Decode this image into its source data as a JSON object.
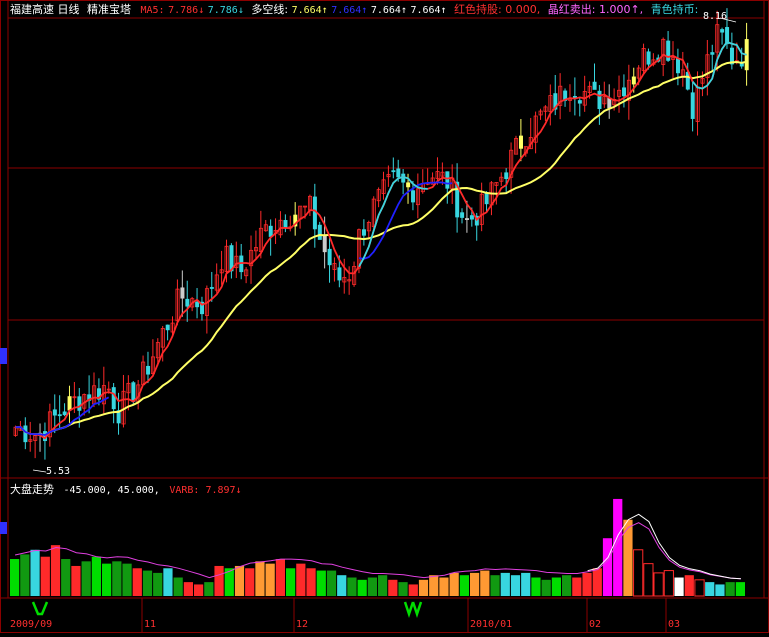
{
  "header": {
    "stock_name": "福建高速",
    "period": "日线",
    "indicator_name": "精准宝塔",
    "ma_label": "MA5:",
    "ma_value1": "7.786↓",
    "ma_value2": "7.786↓",
    "duokong_label": "多空线:",
    "duokong_value1": "7.664↑",
    "duokong_value2": "7.664↑",
    "duokong_value3": "7.664↑",
    "duokong_value4": "7.664↑",
    "red_hold": "红色持股: 0.000,",
    "crystal_sell": "晶红卖出: 1.000↑,",
    "cyan_hold": "青色持币:"
  },
  "sub_header": {
    "name": "大盘走势",
    "range": "-45.000, 45.000,",
    "varb": "VARB: 7.897↓"
  },
  "price_labels": {
    "high": "8.16",
    "low": "5.53"
  },
  "date_labels": [
    "2009/09",
    "11",
    "12",
    "2010/01",
    "02",
    "03"
  ],
  "colors": {
    "background": "#000000",
    "frame": "#8b0000",
    "up": "#ff2a2a",
    "down": "#38d6e0",
    "magenta": "#ff00ff",
    "yellow_line": "#ffff66",
    "blue_line": "#2020ff",
    "green_bar": "#00dd00",
    "dark_green_bar": "#119911",
    "orange_bar": "#ff9933",
    "white_bar": "#ffffff",
    "purple_line": "#e040e0"
  },
  "chart_data": {
    "type": "candlestick",
    "price_range": [
      5.45,
      8.25
    ],
    "sub_range": [
      -45,
      45
    ],
    "price_path": [
      [
        0,
        5.75
      ],
      [
        10,
        5.7
      ],
      [
        20,
        5.85
      ],
      [
        30,
        5.95
      ],
      [
        40,
        6.0
      ],
      [
        45,
        5.85
      ],
      [
        55,
        6.05
      ],
      [
        65,
        6.35
      ],
      [
        72,
        6.55
      ],
      [
        82,
        6.5
      ],
      [
        90,
        6.8
      ],
      [
        98,
        6.7
      ],
      [
        108,
        6.95
      ],
      [
        118,
        7.05
      ],
      [
        128,
        7.08
      ],
      [
        135,
        6.8
      ],
      [
        140,
        6.65
      ],
      [
        146,
        6.7
      ],
      [
        150,
        6.95
      ],
      [
        156,
        7.1
      ],
      [
        164,
        7.25
      ],
      [
        172,
        7.2
      ],
      [
        180,
        7.3
      ],
      [
        188,
        7.25
      ],
      [
        196,
        7.0
      ],
      [
        204,
        7.1
      ],
      [
        212,
        7.3
      ],
      [
        222,
        7.55
      ],
      [
        232,
        7.7
      ],
      [
        242,
        7.85
      ],
      [
        252,
        7.75
      ],
      [
        262,
        7.8
      ],
      [
        272,
        8.0
      ],
      [
        282,
        8.1
      ],
      [
        290,
        7.95
      ],
      [
        295,
        7.7
      ],
      [
        300,
        7.95
      ],
      [
        306,
        8.16
      ],
      [
        312,
        8.0
      ],
      [
        318,
        8.05
      ]
    ],
    "candle_colors": [
      "up",
      "down",
      "up",
      "up",
      "up",
      "down",
      "up",
      "up",
      "magenta",
      "down",
      "up",
      "down",
      "up",
      "up",
      "up",
      "down",
      "down",
      "up",
      "up",
      "up",
      "up",
      "down",
      "up",
      "up",
      "down",
      "up",
      "up",
      "up",
      "up",
      "up",
      "down",
      "up",
      "up",
      "magenta",
      "down",
      "down",
      "up",
      "up",
      "magenta",
      "down"
    ],
    "sub_bars": [
      {
        "v": 16,
        "c": "green_bar"
      },
      {
        "v": 18,
        "c": "dark_green_bar"
      },
      {
        "v": 20,
        "c": "down"
      },
      {
        "v": 17,
        "c": "up"
      },
      {
        "v": 22,
        "c": "up"
      },
      {
        "v": 16,
        "c": "dark_green_bar"
      },
      {
        "v": 13,
        "c": "up"
      },
      {
        "v": 15,
        "c": "dark_green_bar"
      },
      {
        "v": 17,
        "c": "green_bar"
      },
      {
        "v": 14,
        "c": "green_bar"
      },
      {
        "v": 15,
        "c": "dark_green_bar"
      },
      {
        "v": 14,
        "c": "dark_green_bar"
      },
      {
        "v": 12,
        "c": "up"
      },
      {
        "v": 11,
        "c": "dark_green_bar"
      },
      {
        "v": 10,
        "c": "dark_green_bar"
      },
      {
        "v": 12,
        "c": "down"
      },
      {
        "v": 8,
        "c": "dark_green_bar"
      },
      {
        "v": 6,
        "c": "up"
      },
      {
        "v": 5,
        "c": "up"
      },
      {
        "v": 6,
        "c": "dark_green_bar"
      },
      {
        "v": 13,
        "c": "up"
      },
      {
        "v": 12,
        "c": "green_bar"
      },
      {
        "v": 13,
        "c": "orange_bar"
      },
      {
        "v": 12,
        "c": "up"
      },
      {
        "v": 15,
        "c": "orange_bar"
      },
      {
        "v": 14,
        "c": "orange_bar"
      },
      {
        "v": 16,
        "c": "up"
      },
      {
        "v": 12,
        "c": "green_bar"
      },
      {
        "v": 14,
        "c": "up"
      },
      {
        "v": 12,
        "c": "up"
      },
      {
        "v": 11,
        "c": "green_bar"
      },
      {
        "v": 11,
        "c": "dark_green_bar"
      },
      {
        "v": 9,
        "c": "down"
      },
      {
        "v": 8,
        "c": "dark_green_bar"
      },
      {
        "v": 7,
        "c": "green_bar"
      },
      {
        "v": 8,
        "c": "dark_green_bar"
      },
      {
        "v": 9,
        "c": "dark_green_bar"
      },
      {
        "v": 7,
        "c": "up"
      },
      {
        "v": 6,
        "c": "dark_green_bar"
      },
      {
        "v": 5,
        "c": "up"
      },
      {
        "v": 7,
        "c": "orange_bar"
      },
      {
        "v": 9,
        "c": "orange_bar"
      },
      {
        "v": 8,
        "c": "orange_bar"
      },
      {
        "v": 10,
        "c": "orange_bar"
      },
      {
        "v": 9,
        "c": "green_bar"
      },
      {
        "v": 10,
        "c": "orange_bar"
      },
      {
        "v": 11,
        "c": "orange_bar"
      },
      {
        "v": 9,
        "c": "dark_green_bar"
      },
      {
        "v": 10,
        "c": "down"
      },
      {
        "v": 9,
        "c": "down"
      },
      {
        "v": 10,
        "c": "down"
      },
      {
        "v": 8,
        "c": "green_bar"
      },
      {
        "v": 7,
        "c": "dark_green_bar"
      },
      {
        "v": 8,
        "c": "green_bar"
      },
      {
        "v": 9,
        "c": "dark_green_bar"
      },
      {
        "v": 8,
        "c": "up"
      },
      {
        "v": 10,
        "c": "up"
      },
      {
        "v": 12,
        "c": "up"
      },
      {
        "v": 25,
        "c": "magenta"
      },
      {
        "v": 42,
        "c": "magenta"
      },
      {
        "v": 33,
        "c": "orange_bar"
      },
      {
        "v": 20,
        "c": "outline"
      },
      {
        "v": 14,
        "c": "outline"
      },
      {
        "v": 10,
        "c": "outline"
      },
      {
        "v": 11,
        "c": "outline"
      },
      {
        "v": 8,
        "c": "white_bar"
      },
      {
        "v": 9,
        "c": "up"
      },
      {
        "v": 7,
        "c": "outline"
      },
      {
        "v": 6,
        "c": "down"
      },
      {
        "v": 5,
        "c": "down"
      },
      {
        "v": 6,
        "c": "dark_green_bar"
      },
      {
        "v": 6,
        "c": "green_bar"
      }
    ]
  }
}
